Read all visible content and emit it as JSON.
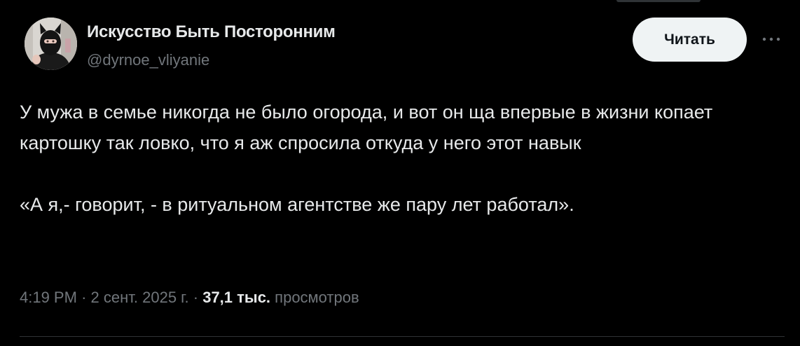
{
  "author": {
    "display_name": "Искусство Быть Посторонним",
    "handle": "@dyrnoe_vliyanie"
  },
  "follow_button": {
    "label": "Читать"
  },
  "more_icon": "more-horizontal-icon",
  "tweet": {
    "paragraph_1": "У мужа в семье никогда не было огорода, и вот он ща впервые в жизни копает картошку так ловко, что я аж спросила откуда у него этот навык",
    "paragraph_2": "«А я,- говорит, - в ритуальном агентстве же пару лет работал»."
  },
  "meta": {
    "time": "4:19 PM",
    "separator": "·",
    "date": "2 сент. 2025 г.",
    "views_count": "37,1 тыс.",
    "views_label": "просмотров"
  },
  "colors": {
    "background": "#000000",
    "text_primary": "#e7e9ea",
    "text_secondary": "#71767b",
    "button_bg": "#eff3f4",
    "divider": "#2f3336"
  }
}
